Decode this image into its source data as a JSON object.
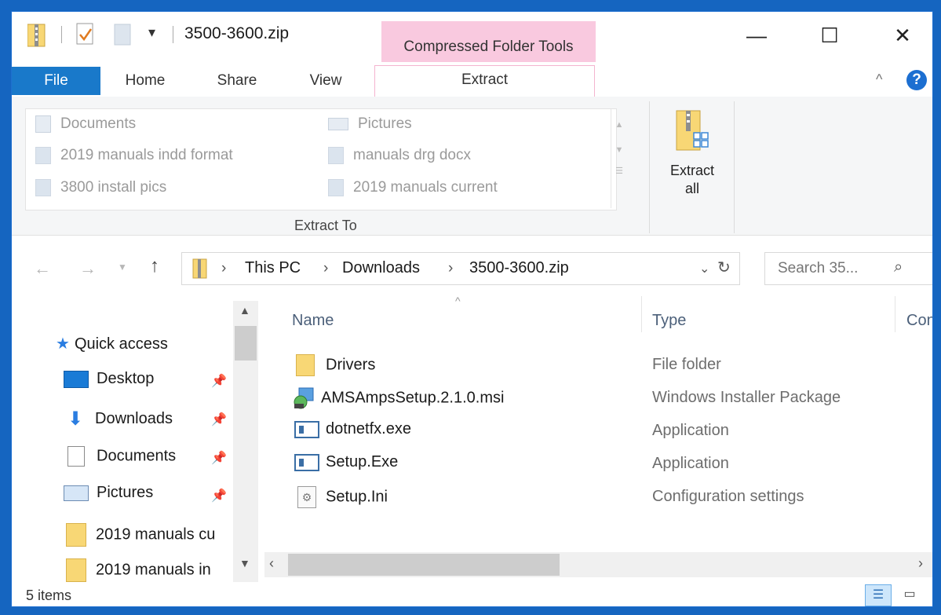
{
  "window": {
    "title": "3500-3600.zip",
    "context_tab": "Compressed Folder Tools",
    "controls": {
      "minimize": "—",
      "maximize": "☐",
      "close": "✕"
    }
  },
  "ribbon": {
    "tabs": [
      "File",
      "Home",
      "Share",
      "View",
      "Extract"
    ],
    "active_tab": "Extract",
    "extract_to": {
      "items_left": [
        "Documents",
        "2019 manuals indd format",
        "3800 install pics"
      ],
      "items_right": [
        "Pictures",
        "manuals drg docx",
        "2019 manuals current"
      ],
      "group_label": "Extract To"
    },
    "extract_all": {
      "line1": "Extract",
      "line2": "all"
    }
  },
  "address": {
    "crumbs": [
      "This PC",
      "Downloads",
      "3500-3600.zip"
    ],
    "search_placeholder": "Search 35..."
  },
  "nav": {
    "quick_access": "Quick access",
    "items": [
      "Desktop",
      "Downloads",
      "Documents",
      "Pictures",
      "2019 manuals cu",
      "2019 manuals in"
    ]
  },
  "content": {
    "columns": [
      "Name",
      "Type",
      "Con"
    ],
    "files": [
      {
        "name": "Drivers",
        "type": "File folder",
        "icon": "folder-icon"
      },
      {
        "name": "AMSAmpsSetup.2.1.0.msi",
        "type": "Windows Installer Package",
        "icon": "msi-icon"
      },
      {
        "name": "dotnetfx.exe",
        "type": "Application",
        "icon": "app-icon"
      },
      {
        "name": "Setup.Exe",
        "type": "Application",
        "icon": "app-icon"
      },
      {
        "name": "Setup.Ini",
        "type": "Configuration settings",
        "icon": "ini-icon"
      }
    ]
  },
  "status": {
    "count": "5 items"
  },
  "colors": {
    "file_tab": "#1979ca",
    "context_pink": "#f9c9df",
    "folder_yellow": "#f8d775",
    "help_blue": "#1c6fd1"
  }
}
